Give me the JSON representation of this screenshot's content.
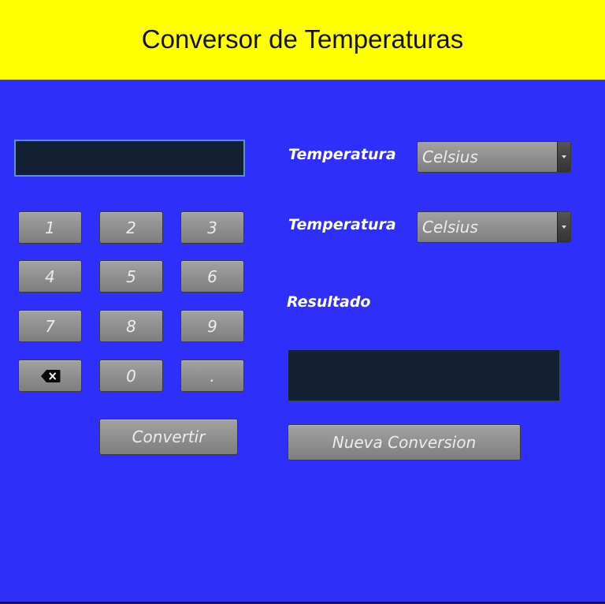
{
  "header": {
    "title": "Conversor de Temperaturas"
  },
  "keypad": {
    "keys": [
      "1",
      "2",
      "3",
      "4",
      "5",
      "6",
      "7",
      "8",
      "9",
      "0",
      "."
    ],
    "backspace_icon": "backspace-icon"
  },
  "actions": {
    "convert_label": "Convertir",
    "new_conversion_label": "Nueva Conversion"
  },
  "form": {
    "from_label": "Temperatura",
    "from_selected": "Celsius",
    "to_label": "Temperatura",
    "to_selected": "Celsius",
    "result_label": "Resultado"
  },
  "colors": {
    "header_bg": "#ffff00",
    "body_bg": "#2f2ffb",
    "display_bg": "#131f33"
  }
}
